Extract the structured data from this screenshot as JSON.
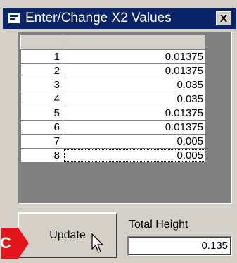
{
  "window": {
    "title": "Enter/Change X2 Values",
    "close_label": "X"
  },
  "grid": {
    "headers": [
      "",
      ""
    ],
    "rows": [
      {
        "index": "1",
        "value": "0.01375"
      },
      {
        "index": "2",
        "value": "0.01375"
      },
      {
        "index": "3",
        "value": "0.035"
      },
      {
        "index": "4",
        "value": "0.035"
      },
      {
        "index": "5",
        "value": "0.01375"
      },
      {
        "index": "6",
        "value": "0.01375"
      },
      {
        "index": "7",
        "value": "0.005"
      },
      {
        "index": "8",
        "value": "0.005"
      }
    ]
  },
  "update_button": {
    "label": "Update"
  },
  "total_height": {
    "label": "Total Height",
    "value": "0.135"
  },
  "callout": {
    "label": "C",
    "color": "#e4141b"
  },
  "colors": {
    "titlebar": "#0a246a",
    "window_face": "#d4d0c8",
    "grid_background": "#808080"
  }
}
